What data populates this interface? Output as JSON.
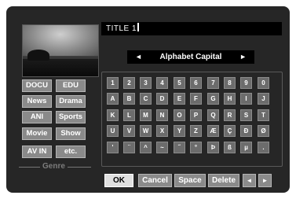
{
  "title_field": {
    "value": "TITLE 1"
  },
  "mode": {
    "label": "Alphabet Capital",
    "prev": "◄",
    "next": "►"
  },
  "genre": {
    "label": "Genre",
    "buttons": [
      "DOCU",
      "EDU",
      "News",
      "Drama",
      "ANI",
      "Sports",
      "Movie",
      "Show",
      "AV IN",
      "etc."
    ]
  },
  "keyboard": {
    "rows": [
      [
        "1",
        "2",
        "3",
        "4",
        "5",
        "6",
        "7",
        "8",
        "9",
        "0"
      ],
      [
        "A",
        "B",
        "C",
        "D",
        "E",
        "F",
        "G",
        "H",
        "I",
        "J"
      ],
      [
        "K",
        "L",
        "M",
        "N",
        "O",
        "P",
        "Q",
        "R",
        "S",
        "T"
      ],
      [
        "U",
        "V",
        "W",
        "X",
        "Y",
        "Z",
        "Æ",
        "Ç",
        "Ð",
        "Ø"
      ],
      [
        "'",
        "¨",
        "^",
        "~",
        "˝",
        "°",
        "Þ",
        "ß",
        "µ",
        "."
      ]
    ]
  },
  "controls": {
    "ok": "OK",
    "cancel": "Cancel",
    "space": "Space",
    "delete": "Delete",
    "left": "◄",
    "right": "►"
  },
  "colors": {
    "background": "#262626",
    "button": "#8a8a8a",
    "key": "#6c6c6c",
    "highlight": "#e0e0e0"
  }
}
